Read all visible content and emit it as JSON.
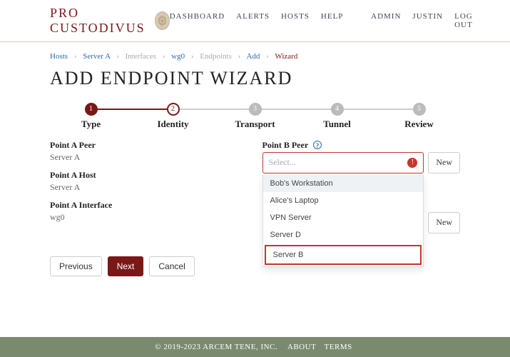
{
  "brand": "PRO CUSTODIVUS",
  "nav": {
    "dashboard": "DASHBOARD",
    "alerts": "ALERTS",
    "hosts": "HOSTS",
    "help": "HELP",
    "admin": "ADMIN",
    "user": "JUSTIN",
    "logout": "LOG OUT"
  },
  "crumbs": {
    "hosts": "Hosts",
    "serverA": "Server A",
    "interfaces": "Interfaces",
    "wg0": "wg0",
    "endpoints": "Endpoints",
    "add": "Add",
    "wizard": "Wizard"
  },
  "title": "ADD ENDPOINT WIZARD",
  "steps": {
    "s1": {
      "num": "1",
      "label": "Type"
    },
    "s2": {
      "num": "2",
      "label": "Identity"
    },
    "s3": {
      "num": "3",
      "label": "Transport"
    },
    "s4": {
      "num": "4",
      "label": "Tunnel"
    },
    "s5": {
      "num": "5",
      "label": "Review"
    }
  },
  "left": {
    "peerLabel": "Point A Peer",
    "peerValue": "Server A",
    "hostLabel": "Point A Host",
    "hostValue": "Server A",
    "ifaceLabel": "Point A Interface",
    "ifaceValue": "wg0"
  },
  "right": {
    "peerLabel": "Point B Peer",
    "selectPlaceholder": "Select...",
    "newBtn": "New",
    "errIcon": "!",
    "options": {
      "o0": "Bob's Workstation",
      "o1": "Alice's Laptop",
      "o2": "VPN Server",
      "o3": "Server D",
      "o4": "Server B"
    },
    "hostNewBtn": "New"
  },
  "buttons": {
    "prev": "Previous",
    "next": "Next",
    "cancel": "Cancel"
  },
  "footer": {
    "copyright": "© 2019-2023 ARCEM TENE, INC.",
    "about": "ABOUT",
    "terms": "TERMS"
  }
}
